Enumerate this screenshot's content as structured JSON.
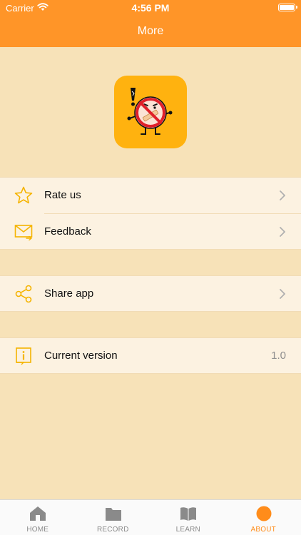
{
  "status_bar": {
    "carrier": "Carrier",
    "time": "4:56 PM"
  },
  "nav": {
    "title": "More"
  },
  "app_icon": {
    "name": "no-smoking-mascot-icon",
    "background": "#ffb20f"
  },
  "menu": {
    "rate": {
      "label": "Rate us",
      "icon": "star-icon"
    },
    "feedback": {
      "label": "Feedback",
      "icon": "mail-icon"
    },
    "share": {
      "label": "Share app",
      "icon": "share-icon"
    },
    "version": {
      "label": "Current version",
      "value": "1.0",
      "icon": "info-icon"
    }
  },
  "tabs": [
    {
      "label": "HOME",
      "icon": "home-icon",
      "active": false
    },
    {
      "label": "RECORD",
      "icon": "folder-icon",
      "active": false
    },
    {
      "label": "LEARN",
      "icon": "book-icon",
      "active": false
    },
    {
      "label": "ABOUT",
      "icon": "circle-icon",
      "active": true
    }
  ],
  "colors": {
    "accent": "#ff9528",
    "background": "#f7e2b8",
    "row_background": "#fcf2e1",
    "icon_yellow": "#f5b400",
    "tab_active": "#ff8c1a",
    "tab_inactive": "#8a8a8a"
  }
}
